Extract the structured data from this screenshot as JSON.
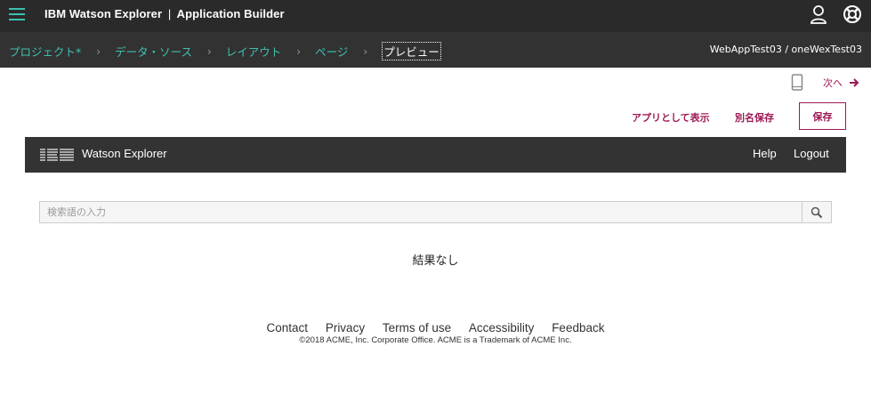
{
  "header": {
    "menu_icon": "hamburger-menu-icon",
    "brand": "IBM Watson Explorer",
    "separator": "|",
    "app_name": "Application Builder",
    "user_icon": "user-icon",
    "help_icon": "help-lifebuoy-icon"
  },
  "breadcrumb": {
    "items": [
      {
        "label": "プロジェクト*"
      },
      {
        "label": "データ・ソース"
      },
      {
        "label": "レイアウト"
      },
      {
        "label": "ページ"
      },
      {
        "label": "プレビュー"
      }
    ],
    "separator_icon": "chevron-right-icon",
    "project_path": "WebAppTest03 / oneWexTest03"
  },
  "preview_toolbar": {
    "device_icon": "mobile-device-icon",
    "next_label": "次へ",
    "next_icon": "arrow-right-icon",
    "view_as_app_label": "アプリとして表示",
    "save_as_label": "別名保存",
    "save_label": "保存"
  },
  "app_preview": {
    "logo_text": "IBM",
    "product_name": "Watson Explorer",
    "nav": {
      "help": "Help",
      "logout": "Logout"
    },
    "search": {
      "placeholder": "検索語の入力",
      "value": "",
      "icon": "search-icon"
    },
    "no_results": "結果なし",
    "footer": {
      "links": [
        "Contact",
        "Privacy",
        "Terms of use",
        "Accessibility",
        "Feedback"
      ],
      "copyright": "©2018 ACME, Inc. Corporate Office. ACME is a Trademark of ACME Inc."
    }
  },
  "colors": {
    "topbar_bg": "#2a2a2a",
    "crumbbar_bg": "#323232",
    "crumb_link": "#40c0b0",
    "accent": "#9b1a55",
    "app_header_bg": "#333333"
  }
}
